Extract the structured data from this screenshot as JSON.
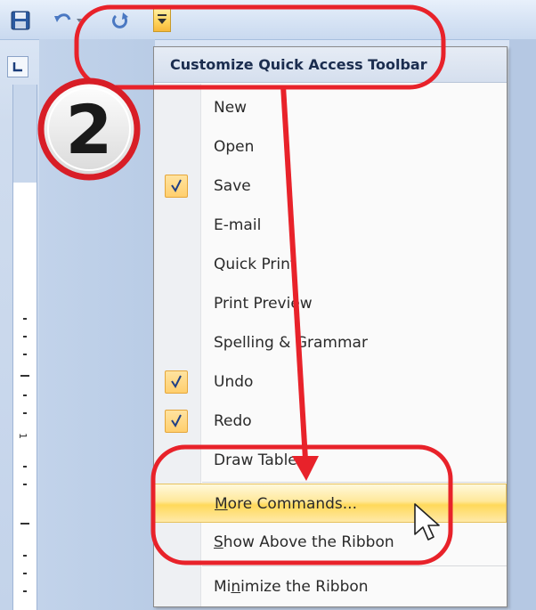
{
  "menu": {
    "title": "Customize Quick Access Toolbar",
    "items": [
      {
        "label": "New",
        "checked": false
      },
      {
        "label": "Open",
        "checked": false
      },
      {
        "label": "Save",
        "checked": true
      },
      {
        "label": "E-mail",
        "checked": false
      },
      {
        "label": "Quick Print",
        "checked": false
      },
      {
        "label": "Print Preview",
        "checked": false
      },
      {
        "label": "Spelling & Grammar",
        "checked": false
      },
      {
        "label": "Undo",
        "checked": true
      },
      {
        "label": "Redo",
        "checked": true
      },
      {
        "label": "Draw Table",
        "checked": false
      }
    ],
    "more_commands": {
      "first": "M",
      "rest": "ore Commands..."
    },
    "show_above": {
      "first": "S",
      "rest": "how Above the Ribbon"
    },
    "minimize": {
      "pre": "Mi",
      "u": "n",
      "post": "imize the Ribbon"
    }
  },
  "annotation": {
    "step_number": "2",
    "accent_color": "#e8222a"
  },
  "icons": [
    "save-icon",
    "undo-icon",
    "redo-icon",
    "dropdown-arrow-icon",
    "tab-stop-icon",
    "checkmark-icon",
    "mouse-cursor-icon"
  ],
  "ruler": {
    "number": "1"
  }
}
